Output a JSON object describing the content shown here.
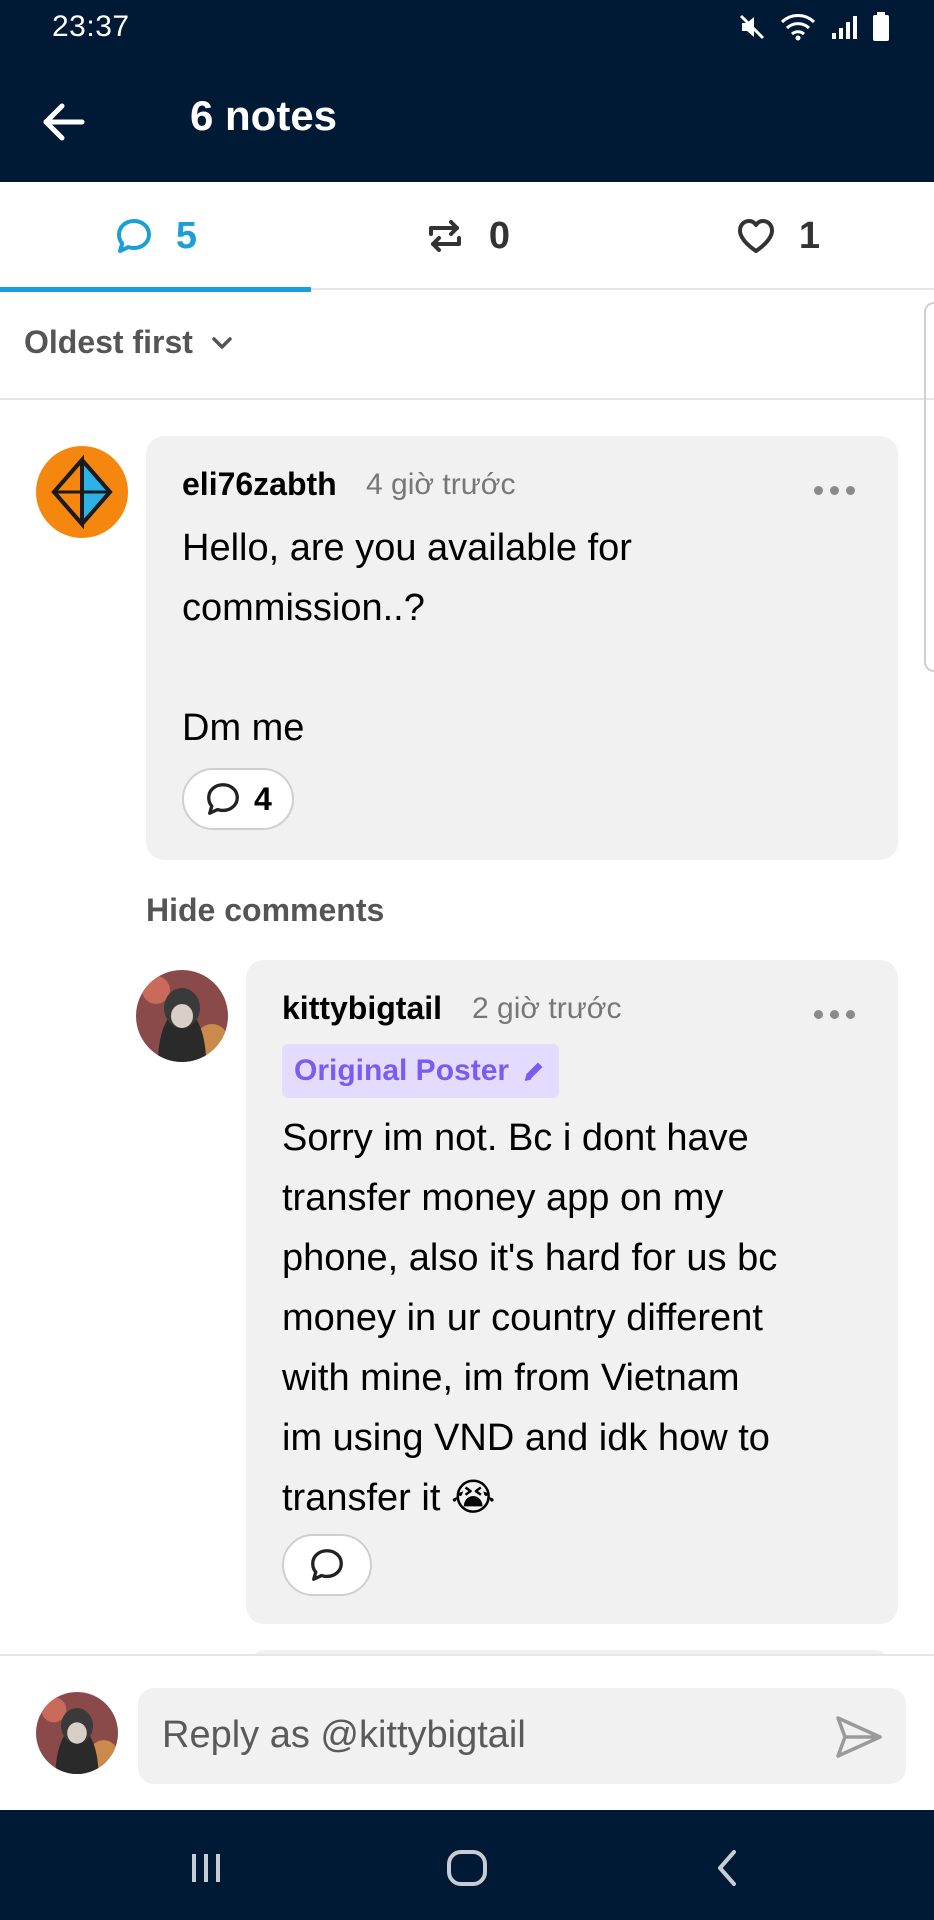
{
  "status_bar": {
    "time": "23:37"
  },
  "app_bar": {
    "title": "6 notes"
  },
  "tabs": [
    {
      "icon": "comment-icon",
      "count": "5",
      "active": true
    },
    {
      "icon": "reblog-icon",
      "count": "0",
      "active": false
    },
    {
      "icon": "heart-icon",
      "count": "1",
      "active": false
    }
  ],
  "sort": {
    "label": "Oldest first"
  },
  "comments": [
    {
      "author": "eli76zabth",
      "time": "4 giờ trước",
      "body": "Hello, are you available for\ncommission..?\n\nDm me",
      "reply_count": "4"
    },
    {
      "author": "kittybigtail",
      "time": "2 giờ trước",
      "badge": "Original Poster",
      "body": "Sorry im not. Bc i dont have\ntransfer money app on my\nphone, also it's hard for us bc\nmoney in ur country different\nwith mine, im from Vietnam\nim using VND and idk how to\ntransfer it 😭"
    }
  ],
  "hide_comments": "Hide comments",
  "compose": {
    "placeholder": "Reply as @kittybigtail"
  },
  "colors": {
    "navy": "#001935",
    "accent_blue": "#1a9fd9",
    "badge_purple": "#7b5cf0",
    "badge_bg": "#e3dcff"
  }
}
